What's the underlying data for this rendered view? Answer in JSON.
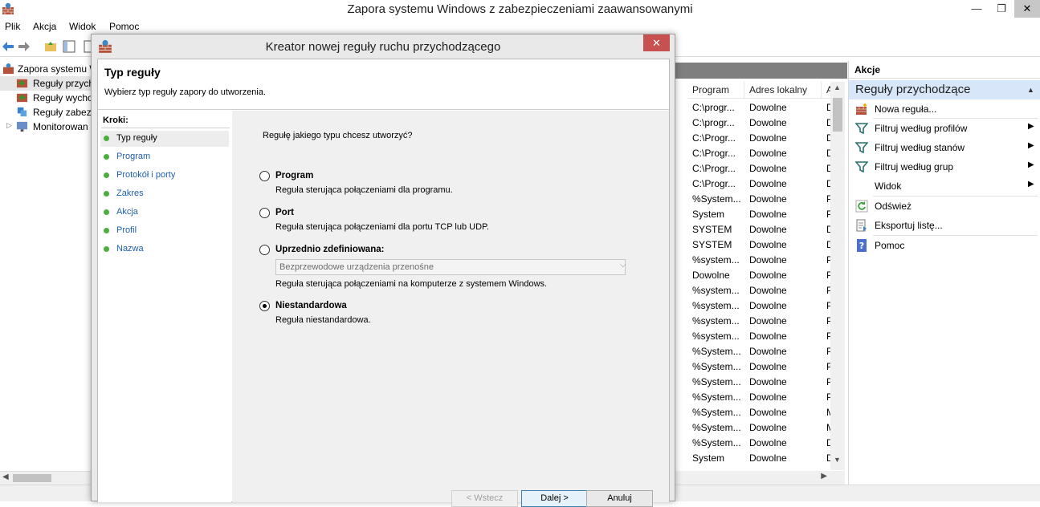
{
  "app": {
    "title": "Zapora systemu Windows z zabezpieczeniami zaawansowanymi",
    "window_buttons": {
      "minimize": "—",
      "restore": "❐",
      "close": "✕"
    }
  },
  "menu": [
    "Plik",
    "Akcja",
    "Widok",
    "Pomoc"
  ],
  "tree": {
    "items": [
      {
        "label": "Zapora systemu W",
        "icon": "firewall-icon"
      },
      {
        "label": "Reguły przych",
        "icon": "inbound-rules-icon"
      },
      {
        "label": "Reguły wycho",
        "icon": "outbound-rules-icon"
      },
      {
        "label": "Reguły zabezp",
        "icon": "security-rules-icon"
      },
      {
        "label": "Monitorowan",
        "icon": "monitor-icon"
      }
    ]
  },
  "list": {
    "headers": [
      "Program",
      "Adres lokalny",
      "A"
    ],
    "rows": [
      [
        "C:\\progr...",
        "Dowolne",
        "D"
      ],
      [
        "C:\\progr...",
        "Dowolne",
        "D"
      ],
      [
        "C:\\Progr...",
        "Dowolne",
        "D"
      ],
      [
        "C:\\Progr...",
        "Dowolne",
        "D"
      ],
      [
        "C:\\Progr...",
        "Dowolne",
        "D"
      ],
      [
        "C:\\Progr...",
        "Dowolne",
        "D"
      ],
      [
        "%System...",
        "Dowolne",
        "P"
      ],
      [
        "System",
        "Dowolne",
        "P"
      ],
      [
        "SYSTEM",
        "Dowolne",
        "D"
      ],
      [
        "SYSTEM",
        "Dowolne",
        "D"
      ],
      [
        "%system...",
        "Dowolne",
        "P"
      ],
      [
        "Dowolne",
        "Dowolne",
        "P"
      ],
      [
        "%system...",
        "Dowolne",
        "P"
      ],
      [
        "%system...",
        "Dowolne",
        "P"
      ],
      [
        "%system...",
        "Dowolne",
        "P"
      ],
      [
        "%system...",
        "Dowolne",
        "P"
      ],
      [
        "%System...",
        "Dowolne",
        "P"
      ],
      [
        "%System...",
        "Dowolne",
        "P"
      ],
      [
        "%System...",
        "Dowolne",
        "P"
      ],
      [
        "%System...",
        "Dowolne",
        "P"
      ],
      [
        "%System...",
        "Dowolne",
        "M"
      ],
      [
        "%System...",
        "Dowolne",
        "M"
      ],
      [
        "%System...",
        "Dowolne",
        "D"
      ],
      [
        "System",
        "Dowolne",
        "D"
      ]
    ]
  },
  "actions": {
    "title": "Akcje",
    "section": "Reguły przychodzące",
    "items": [
      {
        "label": "Nowa reguła...",
        "icon": "new-rule-icon",
        "submenu": false
      },
      {
        "label": "Filtruj według profilów",
        "icon": "filter-icon",
        "submenu": true
      },
      {
        "label": "Filtruj według stanów",
        "icon": "filter-icon",
        "submenu": true
      },
      {
        "label": "Filtruj według grup",
        "icon": "filter-icon",
        "submenu": true
      },
      {
        "label": "Widok",
        "icon": "",
        "submenu": true
      },
      {
        "label": "Odśwież",
        "icon": "refresh-icon",
        "submenu": false
      },
      {
        "label": "Eksportuj listę...",
        "icon": "export-icon",
        "submenu": false
      },
      {
        "label": "Pomoc",
        "icon": "help-icon",
        "submenu": false
      }
    ]
  },
  "dialog": {
    "title": "Kreator nowej reguły ruchu przychodzącego",
    "close": "✕",
    "heading": "Typ reguły",
    "subheading": "Wybierz typ reguły zapory do utworzenia.",
    "steps_title": "Kroki:",
    "steps": [
      "Typ reguły",
      "Program",
      "Protokół i porty",
      "Zakres",
      "Akcja",
      "Profil",
      "Nazwa"
    ],
    "active_step": 0,
    "question": "Regułę jakiego typu chcesz utworzyć?",
    "options": [
      {
        "title": "Program",
        "desc": "Reguła sterująca połączeniami dla programu.",
        "selected": false
      },
      {
        "title": "Port",
        "desc": "Reguła sterująca połączeniami dla portu TCP lub UDP.",
        "selected": false
      },
      {
        "title": "Uprzednio zdefiniowana:",
        "desc": "Reguła sterująca połączeniami na komputerze z systemem Windows.",
        "selected": false
      },
      {
        "title": "Niestandardowa",
        "desc": "Reguła niestandardowa.",
        "selected": true
      }
    ],
    "predefined_select": {
      "value": "Bezprzewodowe urządzenia przenośne",
      "disabled": true
    },
    "buttons": {
      "back": "< Wstecz",
      "next": "Dalej >",
      "cancel": "Anuluj"
    }
  },
  "colors": {
    "accent_section": "#d7e6f8",
    "step_dot": "#4cae3c",
    "step_link": "#1f5fad",
    "close_button": "#c75050"
  }
}
